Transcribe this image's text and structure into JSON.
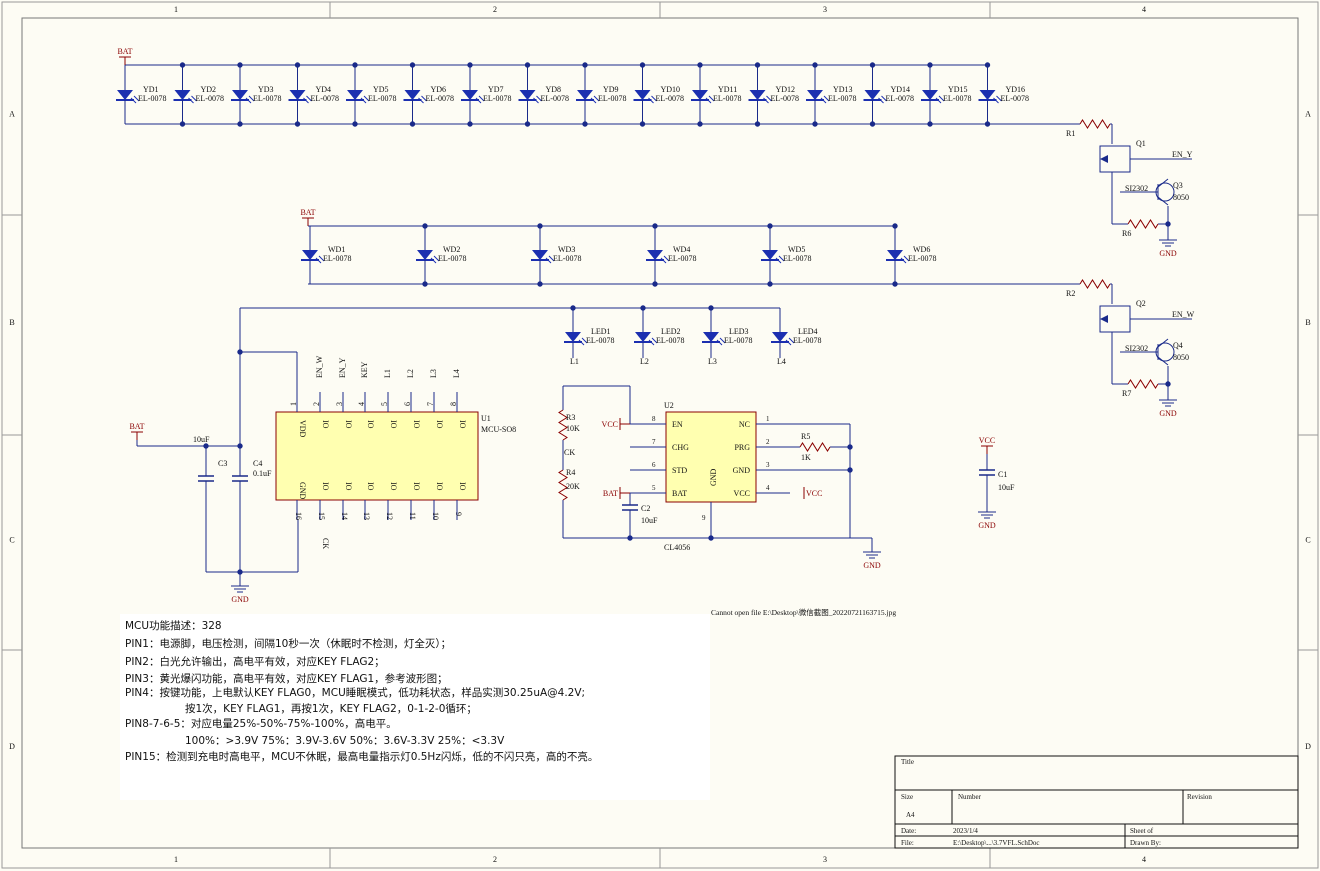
{
  "border": {
    "columns": [
      "1",
      "2",
      "3",
      "4"
    ],
    "rows": [
      "A",
      "B",
      "C",
      "D"
    ]
  },
  "power": {
    "bat": "BAT",
    "vcc": "VCC",
    "gnd": "GND"
  },
  "led_part": "EL-0078",
  "yd_leds": [
    "YD1",
    "YD2",
    "YD3",
    "YD4",
    "YD5",
    "YD6",
    "YD7",
    "YD8",
    "YD9",
    "YD10",
    "YD11",
    "YD12",
    "YD13",
    "YD14",
    "YD15",
    "YD16"
  ],
  "wd_leds": [
    "WD1",
    "WD2",
    "WD3",
    "WD4",
    "WD5",
    "WD6"
  ],
  "ind_leds": [
    "LED1",
    "LED2",
    "LED3",
    "LED4"
  ],
  "ind_nets": [
    "L1",
    "L2",
    "L3",
    "L4"
  ],
  "q_top": {
    "r": "R1",
    "q": "Q1",
    "net": "EN_Y",
    "mos": "SI2302",
    "bjt": "Q3",
    "bjt_type": "8050",
    "r2": "R6"
  },
  "q_bot": {
    "r": "R2",
    "q": "Q2",
    "net": "EN_W",
    "mos": "SI2302",
    "bjt": "Q4",
    "bjt_type": "8050",
    "r2": "R7"
  },
  "mcu": {
    "ref": "U1",
    "part": "MCU-SO8",
    "top_pins": [
      "1",
      "2",
      "3",
      "4",
      "5",
      "6",
      "7",
      "8"
    ],
    "bottom_pins": [
      "16",
      "15",
      "14",
      "13",
      "12",
      "11",
      "10",
      "9"
    ],
    "top_labels": [
      "VDD",
      "IO",
      "IO",
      "IO",
      "IO",
      "IO",
      "IO",
      "IO"
    ],
    "bottom_labels": [
      "GND",
      "IO",
      "IO",
      "IO",
      "IO",
      "IO",
      "IO",
      "IO"
    ],
    "top_nets": [
      "",
      "EN_W",
      "EN_Y",
      "KEY",
      "L1",
      "L2",
      "L3",
      "L4"
    ],
    "bottom_net": "CK"
  },
  "caps": {
    "c3": "C3",
    "c4": "C4",
    "c4_val": "0.1uF",
    "c3_val": "10uF",
    "c1": "C1",
    "c1_val": "10uF",
    "c2": "C2",
    "c2_val": "10uF"
  },
  "charger": {
    "ref": "U2",
    "part": "CL4056",
    "left_pins": [
      {
        "num": "8",
        "name": "EN"
      },
      {
        "num": "7",
        "name": "CHG"
      },
      {
        "num": "6",
        "name": "STD"
      },
      {
        "num": "5",
        "name": "BAT"
      }
    ],
    "right_pins": [
      {
        "num": "1",
        "name": "NC"
      },
      {
        "num": "2",
        "name": "PRG"
      },
      {
        "num": "3",
        "name": "GND"
      },
      {
        "num": "4",
        "name": "VCC"
      }
    ],
    "bottom_pin": {
      "num": "9",
      "name": "GND"
    },
    "r3": "R3",
    "r3_val": "10K",
    "r4": "R4",
    "r4_val": "20K",
    "ck": "CK",
    "r5": "R5",
    "r5_val": "1K"
  },
  "image_error": "Cannot open file E:\\Desktop\\微信截图_20220721163715.jpg",
  "notes": [
    "MCU功能描述：328",
    "PIN1：电源脚，电压检测，间隔10秒一次（休眠时不检测，灯全灭）；",
    "PIN2：白光允许输出，高电平有效，对应KEY FLAG2；",
    "PIN3：黄光爆闪功能，高电平有效，对应KEY FLAG1，参考波形图；",
    "PIN4：按键功能，上电默认KEY FLAG0，MCU睡眠模式，低功耗状态，样品实测30.25uA@4.2V;",
    "按1次，KEY FLAG1，再按1次，KEY FLAG2，0-1-2-0循环；",
    "PIN8-7-6-5：对应电量25%-50%-75%-100%，高电平。",
    "100%：>3.9V    75%：3.9V-3.6V    50%：3.6V-3.3V    25%：<3.3V",
    "PIN15：检测到充电时高电平，MCU不休眠，最高电量指示灯0.5Hz闪烁，低的不闪只亮，高的不亮。"
  ],
  "title_block": {
    "title": "Title",
    "size": "Size",
    "size_val": "A4",
    "number": "Number",
    "revision": "Revision",
    "date": "Date:",
    "date_val": "2023/1/4",
    "sheet": "Sheet    of",
    "file": "File:",
    "file_val": "E:\\Desktop\\...\\3.7VFL.SchDoc",
    "drawn": "Drawn By:"
  }
}
